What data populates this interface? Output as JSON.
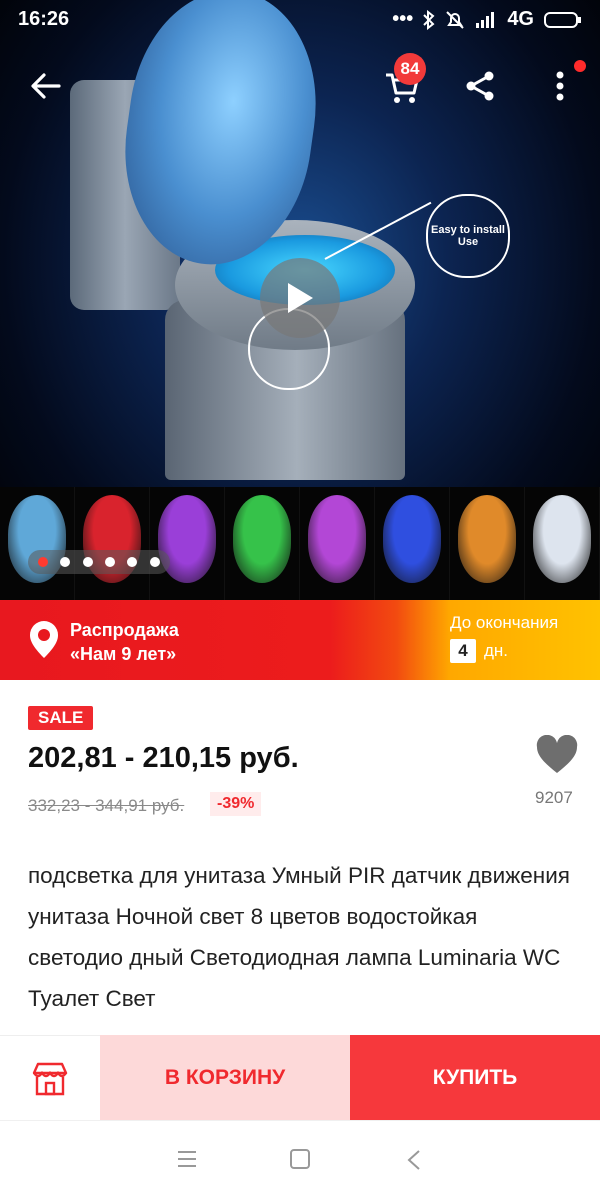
{
  "status_bar": {
    "time": "16:26",
    "network": "4G"
  },
  "header": {
    "cart_count": "84"
  },
  "hero": {
    "callout_line1": "Easy to install",
    "callout_line2": "Use",
    "strip_colors": [
      "#5fa8d8",
      "#d9232d",
      "#9a3fd8",
      "#36c24a",
      "#b347d6",
      "#2f4fe0",
      "#e08a2a",
      "#dde4ee"
    ],
    "carousel_count": 6,
    "carousel_active": 0
  },
  "banner": {
    "line1": "Распродажа",
    "line2": "«Нам 9 лет»",
    "countdown_label": "До окончания",
    "countdown_value": "4",
    "countdown_unit": "дн."
  },
  "product": {
    "sale_badge": "SALE",
    "price": "202,81 - 210,15 руб.",
    "old_price": "332,23 - 344,91 руб.",
    "discount": "-39%",
    "wishlist_count": "9207",
    "title": "подсветка для унитаза Умный PIR датчик движения унитаза Ночной свет 8 цветов водостойкая светодио дный Светодиодная лампа Luminaria WC Туалет Свет"
  },
  "actions": {
    "add_to_cart": "В КОРЗИНУ",
    "buy": "КУПИТЬ"
  }
}
